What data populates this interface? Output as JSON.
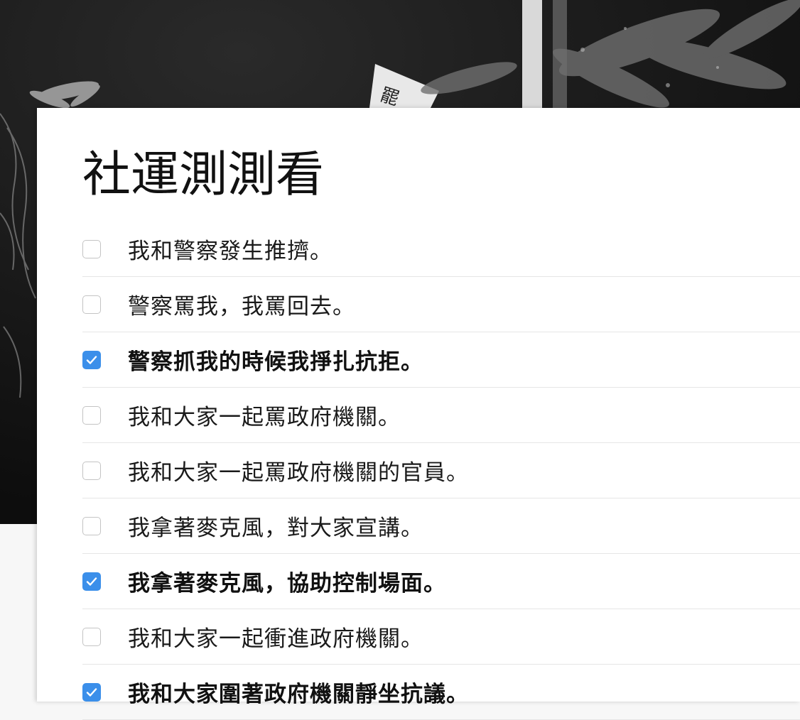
{
  "quiz": {
    "title": "社運測測看",
    "items": [
      {
        "label": "我和警察發生推擠。",
        "checked": false
      },
      {
        "label": "警察罵我，我罵回去。",
        "checked": false
      },
      {
        "label": "警察抓我的時候我掙扎抗拒。",
        "checked": true
      },
      {
        "label": "我和大家一起罵政府機關。",
        "checked": false
      },
      {
        "label": "我和大家一起罵政府機關的官員。",
        "checked": false
      },
      {
        "label": "我拿著麥克風，對大家宣講。",
        "checked": false
      },
      {
        "label": "我拿著麥克風，協助控制場面。",
        "checked": true
      },
      {
        "label": "我和大家一起衝進政府機關。",
        "checked": false
      },
      {
        "label": "我和大家圍著政府機關靜坐抗議。",
        "checked": true
      }
    ]
  },
  "colors": {
    "checkbox_checked": "#3b8fea",
    "checkbox_border": "#c4c4c4",
    "divider": "#e6e6e6"
  },
  "icons": {
    "checkbox_mark": "check-icon"
  }
}
